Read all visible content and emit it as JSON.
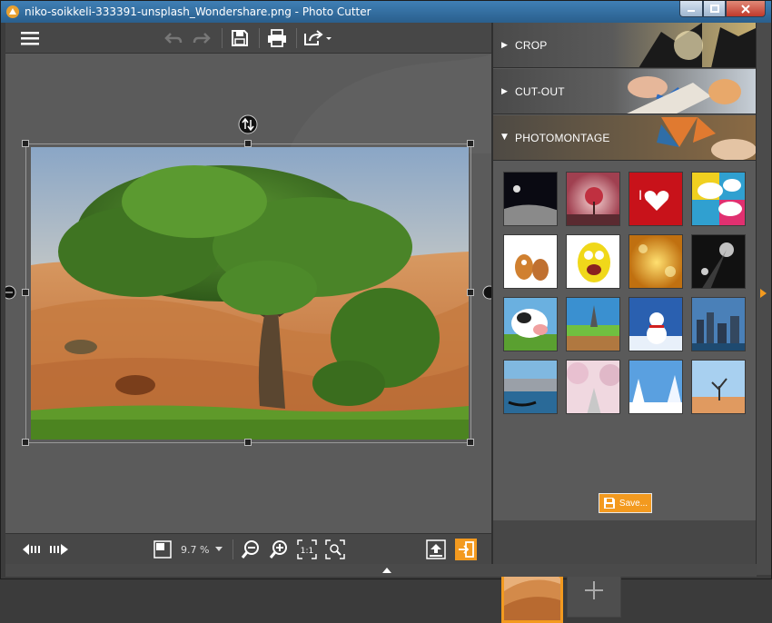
{
  "window": {
    "title": "niko-soikkeli-333391-unsplash_Wondershare.png - Photo Cutter",
    "buttons": [
      "minimize",
      "maximize",
      "close"
    ]
  },
  "toolbar": {
    "icons": [
      "menu-icon",
      "undo-icon",
      "redo-icon",
      "save-icon",
      "print-icon",
      "export-icon"
    ]
  },
  "canvas": {
    "image": "desert tree photo",
    "icons": [
      "rotate-flip-icon"
    ]
  },
  "bottombar": {
    "zoom_value": "9.7 %",
    "icons": [
      "prev-icon",
      "next-icon",
      "fit-size-icon",
      "zoom-dropdown-icon",
      "zoom-out-icon",
      "zoom-in-icon",
      "actual-size-icon",
      "fit-window-icon",
      "upload-icon",
      "exit-panel-icon"
    ]
  },
  "panel": {
    "sections": [
      {
        "label": "CROP",
        "expanded": false
      },
      {
        "label": "CUT-OUT",
        "expanded": false
      },
      {
        "label": "PHOTOMONTAGE",
        "expanded": true
      }
    ],
    "backgrounds": [
      "moon-landscape",
      "heart-tree-sunset",
      "red-heart-grunge",
      "comic-speech-bubbles",
      "cartoon-cow-dog",
      "yellow-monster",
      "golden-bokeh",
      "light-beams",
      "cow-closeup",
      "eiffel-tower-deck",
      "snowman",
      "city-skyline",
      "venice-gondolas",
      "cherry-blossom-path",
      "snowy-forest",
      "desert-dead-tree"
    ],
    "selected_background": "desert-dunes",
    "add_label": "+",
    "save_label": "Save..."
  },
  "colors": {
    "accent": "#f39a1f",
    "panel_bg": "#5a5a5a",
    "toolbar_bg": "#474747"
  }
}
